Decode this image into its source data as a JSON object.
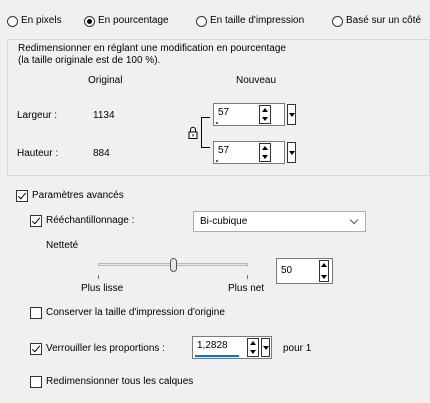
{
  "mode_options": [
    {
      "label": "En pixels",
      "selected": false
    },
    {
      "label": "En pourcentage",
      "selected": true
    },
    {
      "label": "En taille d'impression",
      "selected": false
    },
    {
      "label": "Basé sur un côté",
      "selected": false
    }
  ],
  "resize": {
    "description_line1": "Redimensionner en réglant une modification en pourcentage",
    "description_line2": "(la taille originale est de 100 %).",
    "original_header": "Original",
    "new_header": "Nouveau",
    "width_label": "Largeur :",
    "width_original": "1134",
    "width_new": "57",
    "height_label": "Hauteur :",
    "height_original": "884",
    "height_new": "57"
  },
  "advanced": {
    "label": "Paramètres avancés",
    "checked": true,
    "resample_label": "Rééchantillonnage :",
    "resample_checked": true,
    "resample_method": "Bi-cubique",
    "sharpness_label": "Netteté",
    "sharpness_value": "50",
    "slider_fraction": 0.5,
    "slider_min_label": "Plus lisse",
    "slider_max_label": "Plus net",
    "keep_print_size_label": "Conserver la taille d'impression d'origine",
    "keep_print_size_checked": false,
    "lock_ratio_label": "Verrouiller les proportions :",
    "lock_ratio_checked": true,
    "ratio_value": "1,2828",
    "ratio_suffix": "pour 1",
    "resize_all_layers_label": "Redimensionner tous les calques",
    "resize_all_layers_checked": false
  }
}
